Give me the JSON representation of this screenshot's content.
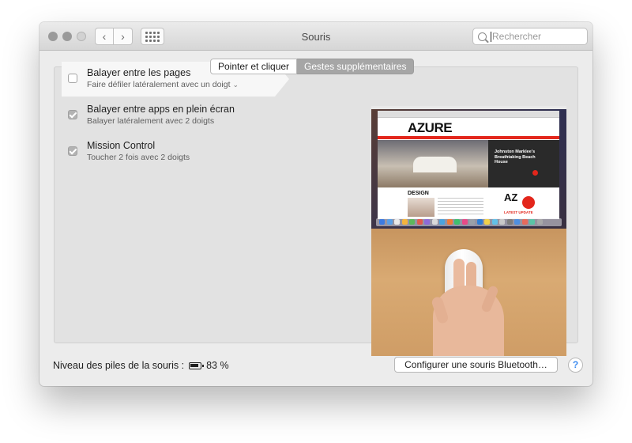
{
  "window": {
    "title": "Souris"
  },
  "toolbar": {
    "back_glyph": "‹",
    "forward_glyph": "›",
    "grid_icon": "show-all-grid-icon"
  },
  "search": {
    "placeholder": "Rechercher",
    "value": ""
  },
  "tabs": [
    {
      "label": "Pointer et cliquer",
      "active": false
    },
    {
      "label": "Gestes supplémentaires",
      "active": true
    }
  ],
  "gestures": [
    {
      "title": "Balayer entre les pages",
      "description": "Faire défiler latéralement avec un doigt",
      "checked": false,
      "selected": true,
      "has_dropdown": true
    },
    {
      "title": "Balayer entre apps en plein écran",
      "description": "Balayer latéralement avec 2 doigts",
      "checked": true,
      "selected": false
    },
    {
      "title": "Mission Control",
      "description": "Toucher 2 fois avec 2 doigts",
      "checked": true,
      "selected": false
    }
  ],
  "preview": {
    "site_logo": "AZURE",
    "headline": "Johnston Marklee's Breathtaking Beach House",
    "section": "DESIGN",
    "side_logo": "AZ",
    "side_label": "LATEST UPDATE"
  },
  "footer": {
    "battery_label": "Niveau des piles de la souris :",
    "battery_percent": "83 %",
    "bluetooth_button": "Configurer une souris Bluetooth…",
    "help_label": "?"
  },
  "colors": {
    "accent_red": "#e3261b",
    "help_blue": "#3d8cf0",
    "active_tab": "#a6a6a6"
  }
}
